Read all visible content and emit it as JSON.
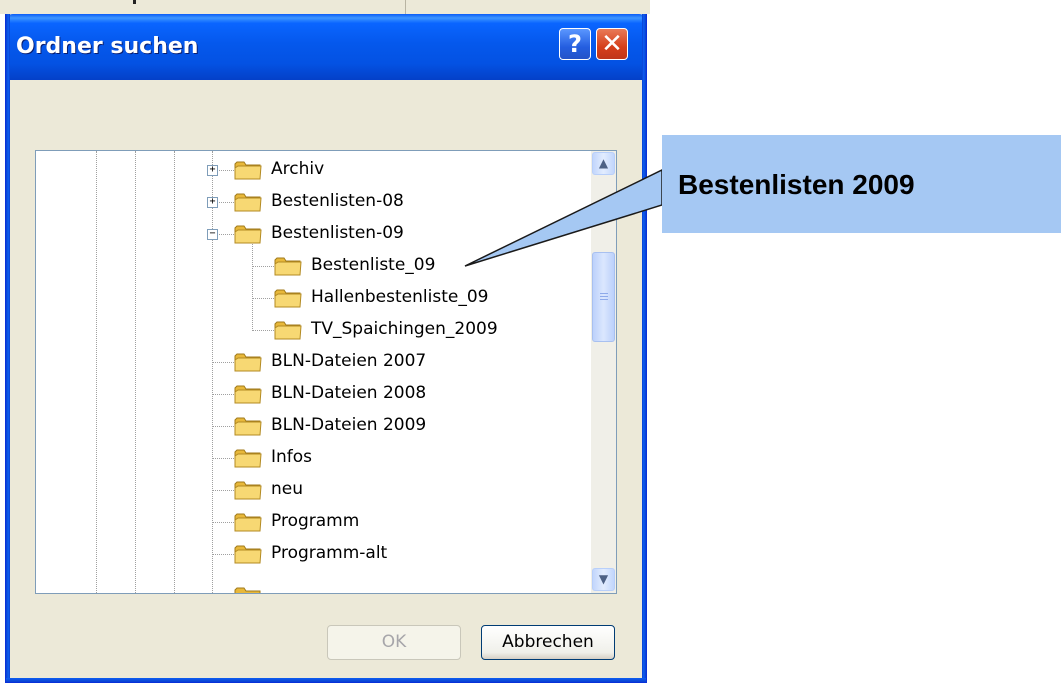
{
  "dialog": {
    "title": "Ordner suchen",
    "help_button": "?",
    "close_button": "✕"
  },
  "tree": {
    "items": [
      {
        "label": "Archiv",
        "expander": "+"
      },
      {
        "label": "Bestenlisten-08",
        "expander": "+"
      },
      {
        "label": "Bestenlisten-09",
        "expander": "−"
      },
      {
        "label": "Bestenliste_09"
      },
      {
        "label": "Hallenbestenliste_09"
      },
      {
        "label": "TV_Spaichingen_2009"
      },
      {
        "label": "BLN-Dateien 2007"
      },
      {
        "label": "BLN-Dateien 2008"
      },
      {
        "label": "BLN-Dateien 2009"
      },
      {
        "label": "Infos"
      },
      {
        "label": "neu"
      },
      {
        "label": "Programm"
      },
      {
        "label": "Programm-alt"
      }
    ],
    "scroll_up": "▲",
    "scroll_down": "▼"
  },
  "buttons": {
    "ok": "OK",
    "cancel": "Abbrechen"
  },
  "callout": {
    "text": "Bestenlisten 2009",
    "fill_color": "#a5c8f3"
  }
}
